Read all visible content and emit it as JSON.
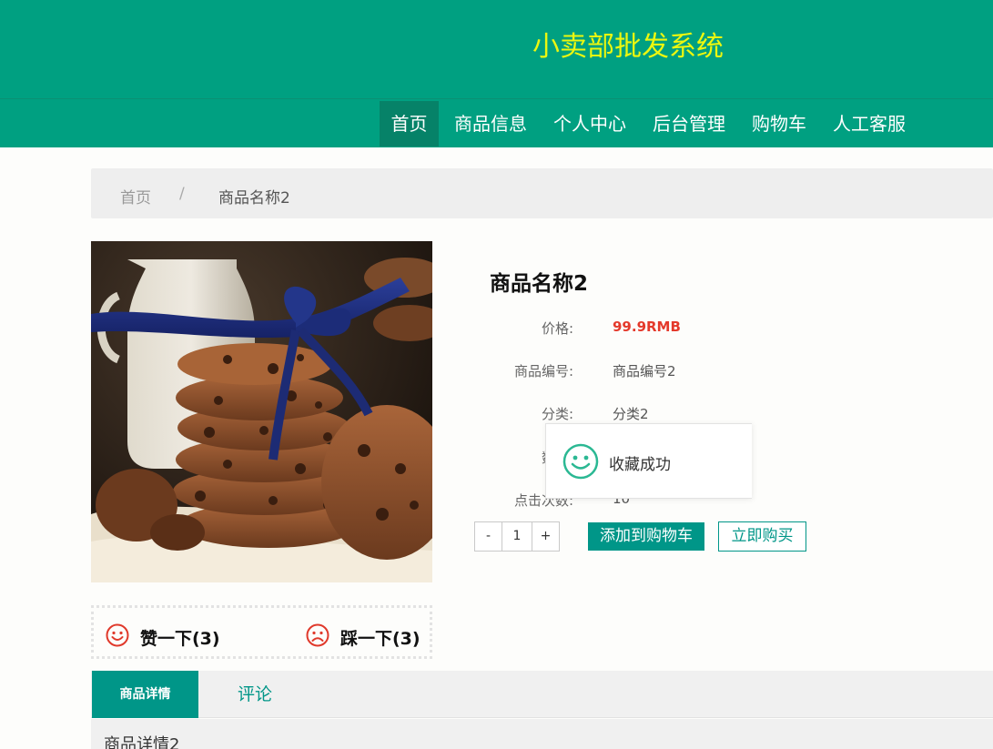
{
  "header": {
    "title": "小卖部批发系统"
  },
  "nav": {
    "items": [
      {
        "label": "首页",
        "active": true
      },
      {
        "label": "商品信息"
      },
      {
        "label": "个人中心"
      },
      {
        "label": "后台管理"
      },
      {
        "label": "购物车"
      },
      {
        "label": "人工客服"
      }
    ]
  },
  "breadcrumb": {
    "home": "首页",
    "separator": "/",
    "current": "商品名称2"
  },
  "product": {
    "name": "商品名称2",
    "image_icon": "cookies-with-ribbon-photo",
    "fields": [
      {
        "label": "价格:",
        "value": "99.9RMB"
      },
      {
        "label": "商品编号:",
        "value": "商品编号2"
      },
      {
        "label": "分类:",
        "value": "分类2"
      },
      {
        "label": "数量:",
        "value": ""
      },
      {
        "label": "点击次数:",
        "value": "10"
      }
    ],
    "quantity": "1",
    "minus": "-",
    "plus": "+",
    "add_to_cart": "添加到购物车",
    "buy_now": "立即购买"
  },
  "toast": {
    "icon": "smile-icon",
    "message": "收藏成功"
  },
  "votes": {
    "like": "赞一下(3)",
    "dislike": "踩一下(3)"
  },
  "tabs": [
    {
      "label": "商品详情",
      "active": true
    },
    {
      "label": "评论"
    }
  ],
  "detail": {
    "text": "商品详情2"
  },
  "colors": {
    "primary": "#00a081",
    "title": "#ecf70f",
    "price": "#e4392b",
    "button": "#009688"
  }
}
